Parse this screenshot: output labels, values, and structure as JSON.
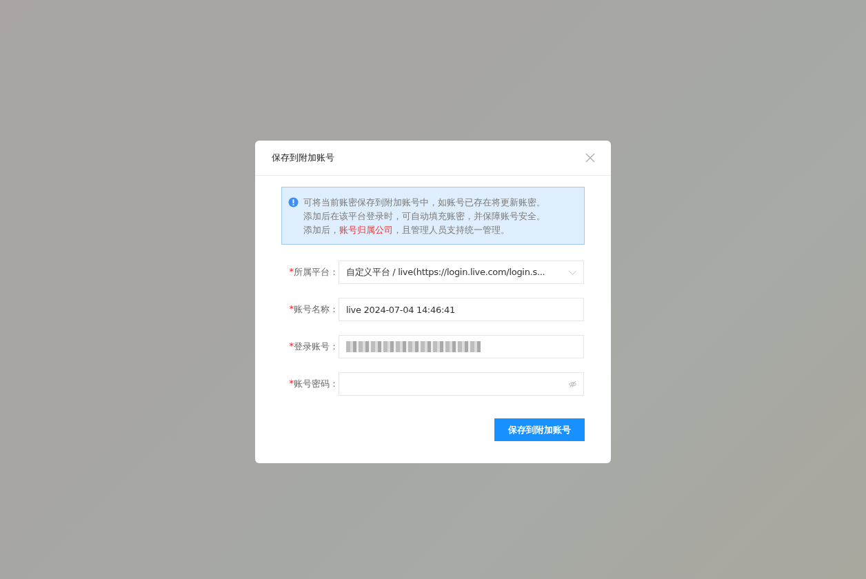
{
  "dialog": {
    "title": "保存到附加账号",
    "notice": {
      "lines": [
        [
          {
            "text": "可将当前账密保存到附加账号中，如账号已存在将更新账密。",
            "highlight": false
          }
        ],
        [
          {
            "text": "添加后在该平台登录时，可自动填充账密，并保障账号安全。",
            "highlight": false
          }
        ],
        [
          {
            "text": "添加后，",
            "highlight": false
          },
          {
            "text": "账号归属公司",
            "highlight": true
          },
          {
            "text": "，且管理人员支持统一管理。",
            "highlight": false
          }
        ]
      ]
    },
    "fields": [
      {
        "kind": "select",
        "required_mark": "*",
        "label": "所属平台：",
        "value": "自定义平台 / live(https://login.live.com/login.s..."
      },
      {
        "kind": "text",
        "required_mark": "*",
        "label": "账号名称：",
        "value": "live 2024-07-04 14:46:41"
      },
      {
        "kind": "redacted",
        "required_mark": "*",
        "label": "登录账号："
      },
      {
        "kind": "password",
        "required_mark": "*",
        "label": "账号密码："
      }
    ],
    "submit_button": "保存到附加账号"
  }
}
